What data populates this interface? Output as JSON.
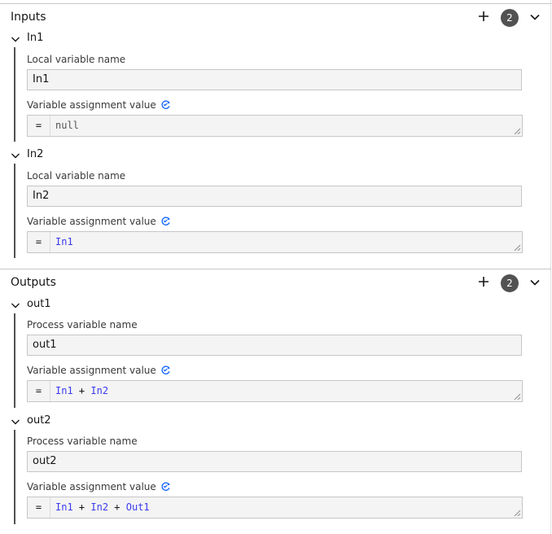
{
  "inputs": {
    "title": "Inputs",
    "count": "2",
    "items": [
      {
        "name": "In1",
        "field1_label": "Local variable name",
        "field1_value": "In1",
        "field2_label": "Variable assignment value",
        "prefix": "=",
        "expr": [
          {
            "text": "null",
            "kind": "kw"
          }
        ]
      },
      {
        "name": "In2",
        "field1_label": "Local variable name",
        "field1_value": "In2",
        "field2_label": "Variable assignment value",
        "prefix": "=",
        "expr": [
          {
            "text": "In1",
            "kind": "var"
          }
        ]
      }
    ]
  },
  "outputs": {
    "title": "Outputs",
    "count": "2",
    "items": [
      {
        "name": "out1",
        "field1_label": "Process variable name",
        "field1_value": "out1",
        "field2_label": "Variable assignment value",
        "prefix": "=",
        "expr": [
          {
            "text": "In1",
            "kind": "var"
          },
          {
            "text": " + ",
            "kind": "op"
          },
          {
            "text": "In2",
            "kind": "var"
          }
        ]
      },
      {
        "name": "out2",
        "field1_label": "Process variable name",
        "field1_value": "out2",
        "field2_label": "Variable assignment value",
        "prefix": "=",
        "expr": [
          {
            "text": "In1",
            "kind": "var"
          },
          {
            "text": " + ",
            "kind": "op"
          },
          {
            "text": "In2",
            "kind": "var"
          },
          {
            "text": " + ",
            "kind": "op"
          },
          {
            "text": "Out1",
            "kind": "var"
          }
        ]
      }
    ]
  },
  "icons": {
    "add": "plus-icon",
    "collapse": "chevron-down-icon",
    "feel": "feel-expression-icon",
    "resize": "resize-grip-icon"
  },
  "colors": {
    "badge": "#525252",
    "feel_icon": "#0f62fe",
    "variable": "#3a3af0",
    "field_bg": "#f4f4f4"
  }
}
